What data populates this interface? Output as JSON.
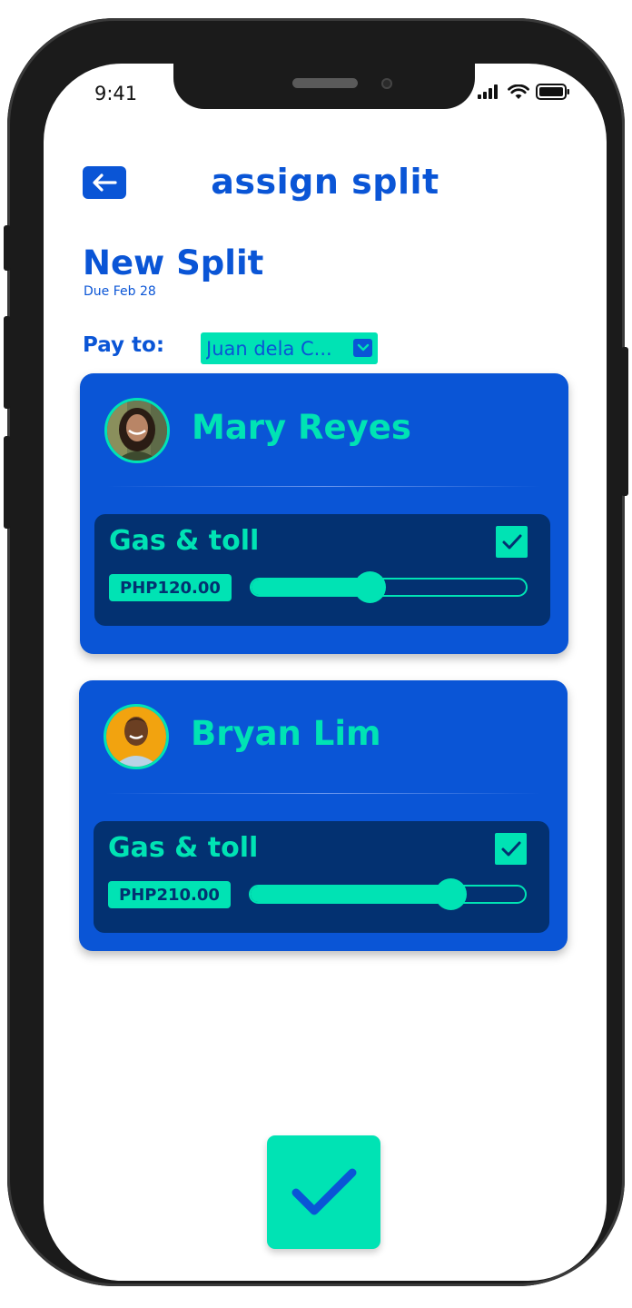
{
  "status_bar": {
    "time": "9:41"
  },
  "header": {
    "title": "assign split",
    "back_icon": "arrow-left-icon"
  },
  "split": {
    "title": "New Split",
    "due": "Due Feb 28"
  },
  "pay_to": {
    "label": "Pay to:",
    "value": "Juan dela C..."
  },
  "members": [
    {
      "name": "Mary Reyes",
      "items": [
        {
          "name": "Gas & toll",
          "checked": true,
          "amount": "PHP120.00",
          "share": 0.43
        }
      ]
    },
    {
      "name": "Bryan Lim",
      "items": [
        {
          "name": "Gas & toll",
          "checked": true,
          "amount": "PHP210.00",
          "share": 0.73
        }
      ]
    }
  ],
  "confirm": {
    "icon": "check-icon"
  },
  "colors": {
    "primary": "#0a55d6",
    "accent": "#00e3b4",
    "panel": "#033171"
  }
}
